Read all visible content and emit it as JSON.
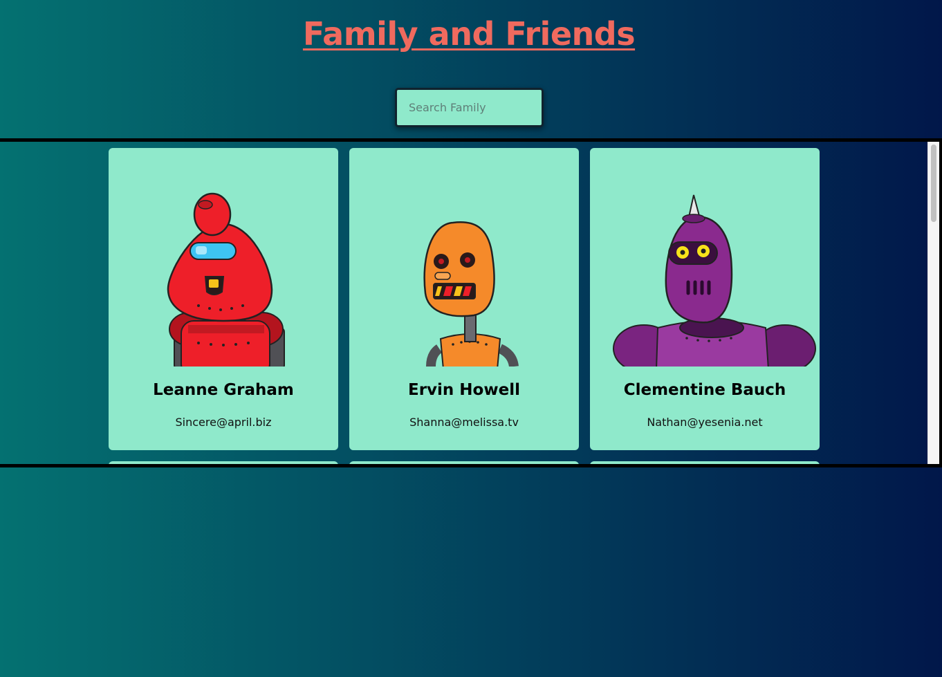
{
  "page": {
    "title": "Family and Friends"
  },
  "search": {
    "placeholder": "Search Family",
    "value": ""
  },
  "cards": [
    {
      "name": "Leanne Graham",
      "email": "Sincere@april.biz",
      "avatar": "red-robot-icon",
      "color": "#ee1f29"
    },
    {
      "name": "Ervin Howell",
      "email": "Shanna@melissa.tv",
      "avatar": "orange-robot-icon",
      "color": "#f58a2a"
    },
    {
      "name": "Clementine Bauch",
      "email": "Nathan@yesenia.net",
      "avatar": "purple-robot-icon",
      "color": "#8a2a8e"
    }
  ],
  "colors": {
    "title": "#f06a5e",
    "card_background": "#8fe9cb",
    "gradient_start": "#047171",
    "gradient_end": "#01174a"
  }
}
